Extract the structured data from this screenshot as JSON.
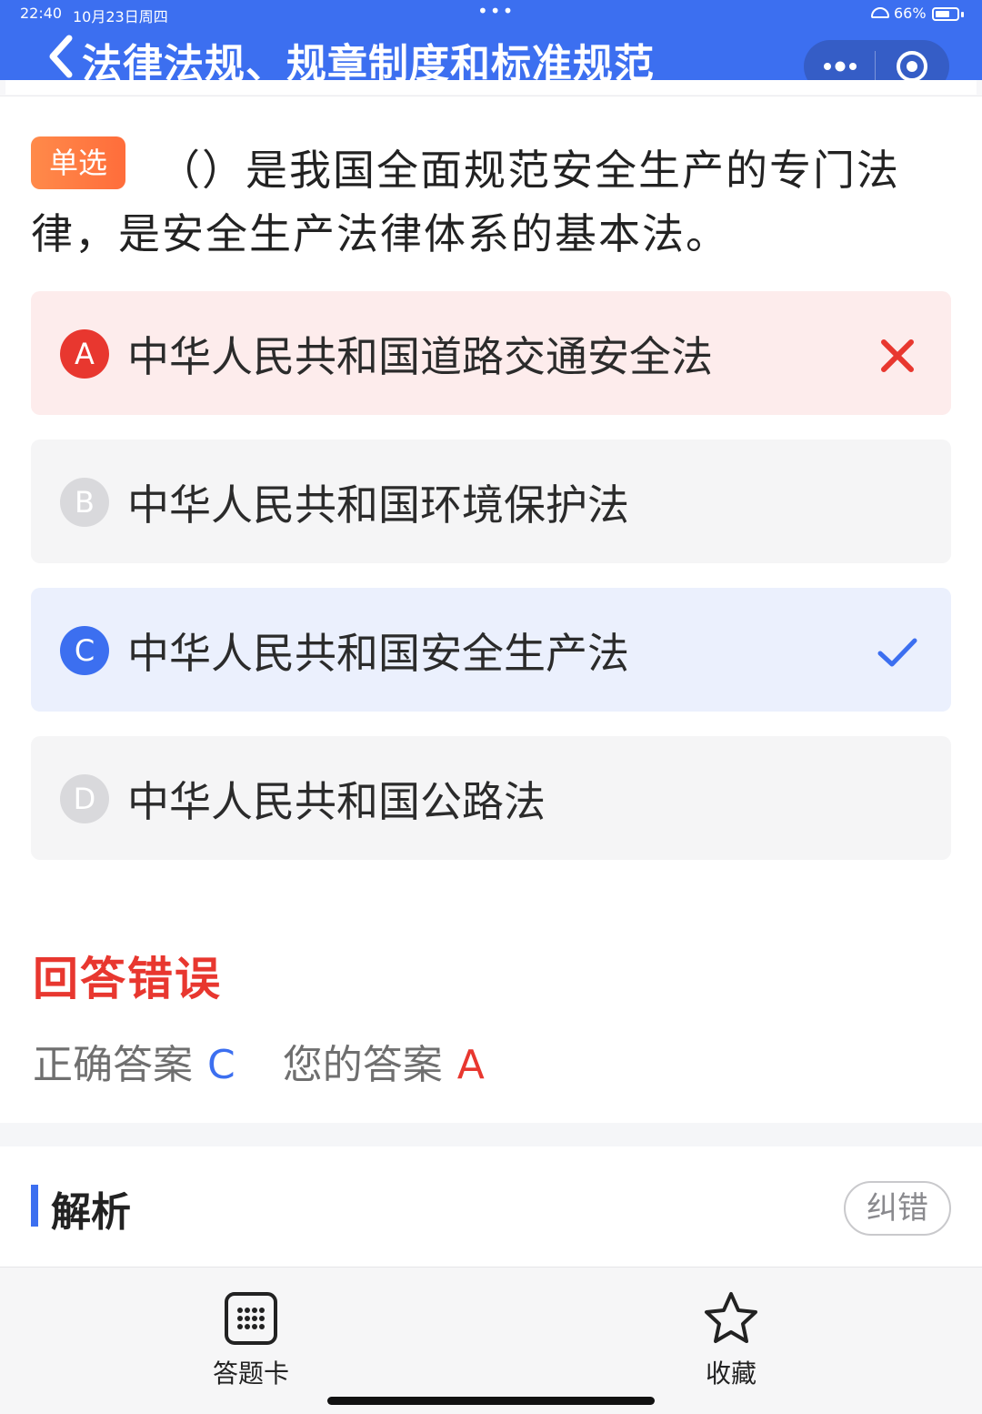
{
  "status_bar": {
    "time": "22:40",
    "date": "10月23日周四",
    "dots": "•••",
    "battery": "66%",
    "battery_level_percent": 66
  },
  "header": {
    "title": "法律法规、规章制度和标准规范",
    "back_icon": "chevron-left-icon",
    "more_icon": "more-dots-icon",
    "target_icon": "target-icon"
  },
  "question": {
    "type_badge": "单选",
    "text": "（）是我国全面规范安全生产的专门法律，是安全生产法律体系的基本法。"
  },
  "options": [
    {
      "letter": "A",
      "text": "中华人民共和国道路交通安全法",
      "state": "wrong"
    },
    {
      "letter": "B",
      "text": "中华人民共和国环境保护法",
      "state": "neutral"
    },
    {
      "letter": "C",
      "text": "中华人民共和国安全生产法",
      "state": "correct"
    },
    {
      "letter": "D",
      "text": "中华人民共和国公路法",
      "state": "neutral"
    }
  ],
  "result": {
    "title": "回答错误",
    "correct_label": "正确答案",
    "correct_value": "C",
    "user_label": "您的答案",
    "user_value": "A"
  },
  "analysis": {
    "title": "解析",
    "report_button": "纠错"
  },
  "bottom_bar": {
    "answer_card_label": "答题卡",
    "favorite_label": "收藏"
  },
  "colors": {
    "primary": "#3c6ff0",
    "error": "#e8372f",
    "badge": "#ff7a43"
  }
}
